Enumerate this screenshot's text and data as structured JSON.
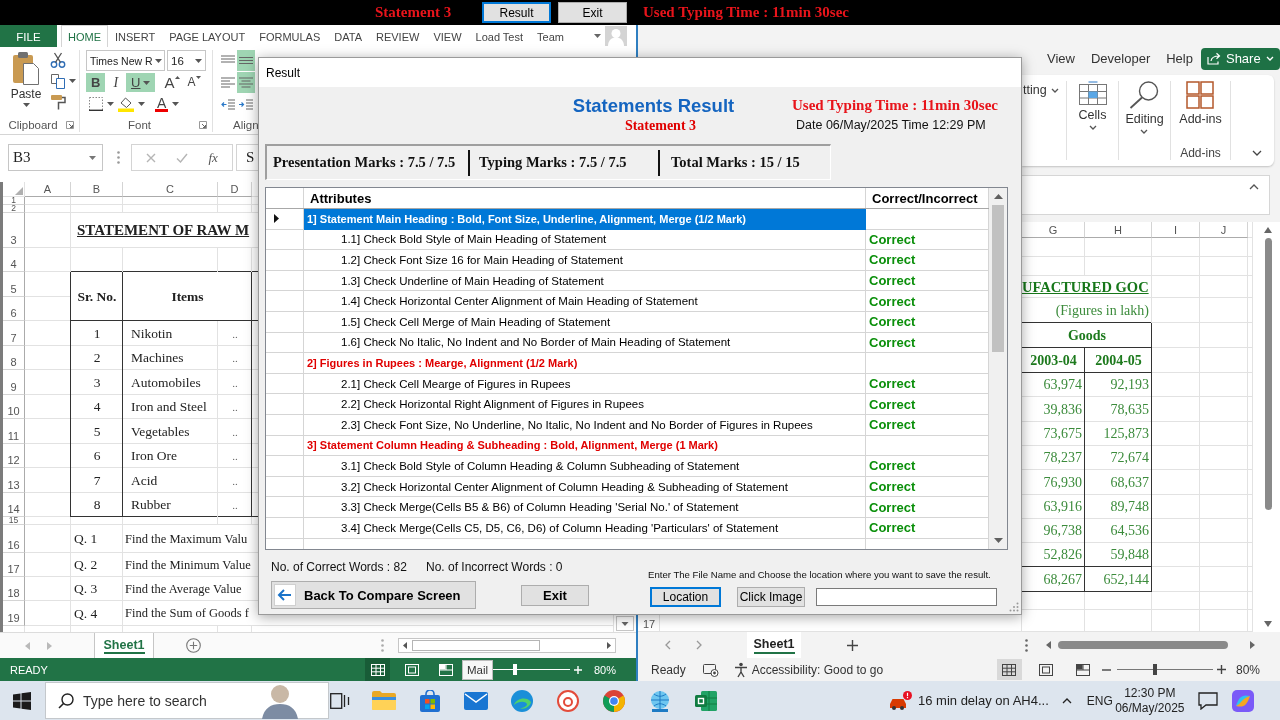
{
  "top_bar": {
    "title": "Statement 3",
    "buttons": [
      {
        "label": "Result",
        "selected": true
      },
      {
        "label": "Exit",
        "selected": false
      }
    ],
    "typing_time": "Used Typing Time : 11min 30sec"
  },
  "left_window": {
    "tabs": [
      {
        "label": "FILE",
        "kind": "file",
        "selected": false
      },
      {
        "label": "HOME",
        "kind": "tab",
        "selected": true
      },
      {
        "label": "INSERT",
        "kind": "tab",
        "selected": false
      },
      {
        "label": "PAGE LAYOUT",
        "kind": "tab",
        "selected": false
      },
      {
        "label": "FORMULAS",
        "kind": "tab",
        "selected": false
      },
      {
        "label": "DATA",
        "kind": "tab",
        "selected": false
      },
      {
        "label": "REVIEW",
        "kind": "tab",
        "selected": false
      },
      {
        "label": "VIEW",
        "kind": "tab",
        "selected": false
      },
      {
        "label": "Load Test",
        "kind": "tab",
        "selected": false
      },
      {
        "label": "Team",
        "kind": "tab",
        "selected": false
      }
    ],
    "clipboard": {
      "paste": "Paste",
      "label": "Clipboard"
    },
    "font": {
      "name": "Times New R",
      "size": "16",
      "styles": [
        {
          "label": "B",
          "selected": true
        },
        {
          "label": "I",
          "selected": false
        },
        {
          "label": "U",
          "selected": true
        }
      ],
      "letter_buttons": [
        {
          "label": "A",
          "kind": "grow"
        },
        {
          "label": "A",
          "kind": "shrink"
        },
        {
          "label": "A",
          "kind": "tint"
        }
      ],
      "label": "Font"
    },
    "alignment": {
      "buttons": [
        {
          "kind": "top",
          "selected": false
        },
        {
          "kind": "middle",
          "selected": true
        },
        {
          "kind": "left",
          "selected": false
        },
        {
          "kind": "center",
          "selected": true
        },
        {
          "kind": "outdent",
          "selected": false
        },
        {
          "kind": "indent",
          "selected": false
        }
      ],
      "label": "Align"
    },
    "name_box": "B3",
    "fx": "fx",
    "formula": "S",
    "columns": [
      "A",
      "B",
      "C",
      "D"
    ],
    "row_numbers": [
      "1",
      "2",
      "3",
      "4",
      "5",
      "6",
      "7",
      "8",
      "9",
      "10",
      "11",
      "12",
      "13",
      "14",
      "15",
      "16",
      "17",
      "18",
      "19"
    ],
    "heading": "STATEMENT OF RAW M",
    "table": {
      "columns": [
        "Sr. No.",
        "Items"
      ],
      "rows": [
        {
          "no": "1",
          "item": "Nikotin",
          "value": ".."
        },
        {
          "no": "2",
          "item": "Machines",
          "value": ".."
        },
        {
          "no": "3",
          "item": "Automobiles",
          "value": ".."
        },
        {
          "no": "4",
          "item": "Iron and Steel",
          "value": ".."
        },
        {
          "no": "5",
          "item": "Vegetables",
          "value": ".."
        },
        {
          "no": "6",
          "item": "Iron Ore",
          "value": ".."
        },
        {
          "no": "7",
          "item": "Acid",
          "value": ".."
        },
        {
          "no": "8",
          "item": "Rubber",
          "value": ".."
        }
      ]
    },
    "questions": [
      {
        "no": "Q. 1",
        "text": "Find the Maximum Valu"
      },
      {
        "no": "Q. 2",
        "text": "Find the Minimum Value"
      },
      {
        "no": "Q. 3",
        "text": "Find the Average Value"
      },
      {
        "no": "Q. 4",
        "text": "Find the Sum of Goods f"
      }
    ],
    "sheet_tab": "Sheet1",
    "status": "READY",
    "view_buttons": [
      {
        "selected": true
      },
      {
        "selected": false
      },
      {
        "selected": false
      }
    ],
    "zoom_slider": {
      "level": 0.45
    },
    "zoom": "80%"
  },
  "right_window": {
    "tabs": [
      "View",
      "Developer",
      "Help"
    ],
    "share": "Share",
    "ribbon_fragment": "tting",
    "groups": [
      {
        "label": "Cells",
        "kind": "cells"
      },
      {
        "label": "Editing",
        "kind": "editing"
      },
      {
        "label": "Add-ins",
        "kind": "addins",
        "group_label": "Add-ins"
      }
    ],
    "columns": [
      "G",
      "H",
      "I",
      "J"
    ],
    "heading": "UFACTURED GOC",
    "note": "(Figures in lakh)",
    "group_heading": "Goods",
    "years": [
      "2003-04",
      "2004-05"
    ],
    "rows": [
      [
        "63,974",
        "92,193"
      ],
      [
        "39,836",
        "78,635"
      ],
      [
        "73,675",
        "125,873"
      ],
      [
        "78,237",
        "72,674"
      ],
      [
        "76,930",
        "68,637"
      ],
      [
        "63,916",
        "89,748"
      ],
      [
        "96,738",
        "64,536"
      ],
      [
        "52,826",
        "59,848"
      ]
    ],
    "total": [
      "68,267",
      "652,144"
    ],
    "row_number": "17",
    "sheet_tab": "Sheet1",
    "status": "Ready",
    "accessibility": "Accessibility: Good to go",
    "view_buttons": [
      {
        "selected": true
      },
      {
        "selected": false
      },
      {
        "selected": false
      }
    ],
    "zoom_slider": {
      "level": 0.4
    },
    "zoom": "80%"
  },
  "dialog": {
    "title": "Result",
    "heading": "Statements Result",
    "subheading": "Statement 3",
    "typing_time": "Used Typing Time : 11min 30sec",
    "date": "Date 06/May/2025 Time 12:29 PM",
    "marks": [
      "Presentation Marks : 7.5 / 7.5",
      "Typing Marks : 7.5 / 7.5",
      "Total Marks : 15 / 15"
    ],
    "table": {
      "columns": [
        "Attributes",
        "Correct/Incorrect"
      ],
      "rows": [
        {
          "kind": "section",
          "text": "1] Statement Main Heading : Bold, Font Size, Underline, Alignment, Merge (1/2 Mark)",
          "selected": true
        },
        {
          "kind": "check",
          "text": "1.1] Check Bold Style of Main Heading of Statement",
          "result": "Correct",
          "selected": false
        },
        {
          "kind": "check",
          "text": "1.2] Check Font Size 16 for Main Heading of Statement",
          "result": "Correct",
          "selected": false
        },
        {
          "kind": "check",
          "text": "1.3] Check Underline of Main Heading of Statement",
          "result": "Correct",
          "selected": false
        },
        {
          "kind": "check",
          "text": "1.4] Check Horizontal Center Alignment of Main Heading of Statement",
          "result": "Correct",
          "selected": false
        },
        {
          "kind": "check",
          "text": "1.5] Check Cell Merge of Main Heading of Statement",
          "result": "Correct",
          "selected": false
        },
        {
          "kind": "check",
          "text": "1.6] Check No Italic, No Indent and No Border of Main Heading of Statement",
          "result": "Correct",
          "selected": false
        },
        {
          "kind": "section",
          "text": "2] Figures in Rupees : Mearge, Alignment (1/2 Mark)",
          "selected": false
        },
        {
          "kind": "check",
          "text": "2.1] Check Cell Mearge of Figures in Rupees",
          "result": "Correct",
          "selected": false
        },
        {
          "kind": "check",
          "text": "2.2] Check Horizontal Right Alignment of Figures in Rupees",
          "result": "Correct",
          "selected": false
        },
        {
          "kind": "check",
          "text": "2.3] Check Font Size, No Underline, No Italic, No Indent and No Border of Figures in Rupees",
          "result": "Correct",
          "selected": false
        },
        {
          "kind": "section",
          "text": "3] Statement Column Heading & Subheading : Bold, Alignment, Merge (1 Mark)",
          "selected": false
        },
        {
          "kind": "check",
          "text": "3.1] Check Bold Style of Column Heading & Column Subheading of Statement",
          "result": "Correct",
          "selected": false
        },
        {
          "kind": "check",
          "text": "3.2] Check Horizontal Center Alignment of Column Heading & Subheading of Statement",
          "result": "Correct",
          "selected": false
        },
        {
          "kind": "check",
          "text": "3.3] Check Merge(Cells B5 & B6) of Column Heading 'Serial No.' of Statement",
          "result": "Correct",
          "selected": false
        },
        {
          "kind": "check",
          "text": "3.4] Check Merge(Cells C5, D5, C6, D6) of Column Heading 'Particulars' of Statement",
          "result": "Correct",
          "selected": false
        }
      ]
    },
    "correct_words": "No. of Correct Words : 82",
    "incorrect_words": "No. of Incorrect Words : 0",
    "save_hint": "Enter The File Name and Choose the location where you want to save the result.",
    "back_button": "Back To Compare Screen",
    "exit_button": "Exit",
    "location_button": {
      "label": "Location",
      "focused": true
    },
    "image_button": "Click Image"
  },
  "tooltip": "Mail",
  "taskbar": {
    "search": {
      "placeholder": "Type here to search"
    },
    "notice": "16 min delay on AH4...",
    "language": "ENG",
    "time": "12:30 PM",
    "date": "06/May/2025"
  }
}
